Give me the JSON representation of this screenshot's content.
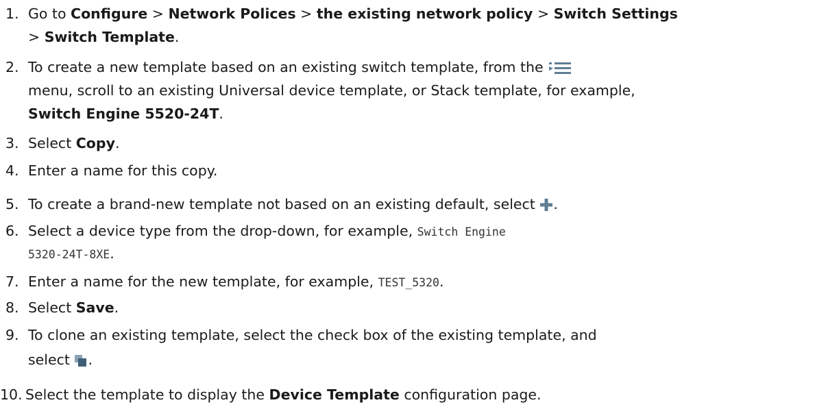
{
  "steps": [
    {
      "number": "1.",
      "parts": {
        "t1": "Go to ",
        "b1": "Configure",
        "t2": " > ",
        "b2": "Network Polices",
        "t3": " > ",
        "b3": "the existing network policy",
        "t4": " > ",
        "b4": "Switch Settings",
        "t5": "> ",
        "b5": "Switch Template",
        "t6": "."
      }
    },
    {
      "number": "2.",
      "parts": {
        "t1": "To create a new template based on an existing switch template, from the ",
        "t2": "menu, scroll to an existing Universal device template, or Stack template, for example,",
        "b1": "Switch Engine 5520-24T",
        "t3": "."
      },
      "icon": "menu-list-icon"
    },
    {
      "number": "3.",
      "parts": {
        "t1": "Select ",
        "b1": "Copy",
        "t2": "."
      }
    },
    {
      "number": "4.",
      "parts": {
        "t1": "Enter a name for this copy."
      }
    },
    {
      "number": "5.",
      "parts": {
        "t1": "To create a brand-new template not based on an existing default, select ",
        "t2": "."
      },
      "icon": "plus-icon"
    },
    {
      "number": "6.",
      "parts": {
        "t1": "Select a device type from the drop-down, for example, ",
        "m1": "Switch Engine",
        "m2": "5320-24T-8XE",
        "t2": "."
      }
    },
    {
      "number": "7.",
      "parts": {
        "t1": "Enter a name for the new template, for example, ",
        "m1": "TEST_5320",
        "t2": "."
      }
    },
    {
      "number": "8.",
      "parts": {
        "t1": "Select ",
        "b1": "Save",
        "t2": "."
      }
    },
    {
      "number": "9.",
      "parts": {
        "t1": "To clone an existing template, select the check box of the existing template, and",
        "t2": "select ",
        "t3": "."
      },
      "icon": "clone-icon"
    },
    {
      "number": "10.",
      "parts": {
        "t1": "Select the template to display the ",
        "b1": "Device Template",
        "t2": " configuration page."
      }
    }
  ],
  "colors": {
    "icon": "#5f7d93",
    "text": "#1a1a1a"
  }
}
